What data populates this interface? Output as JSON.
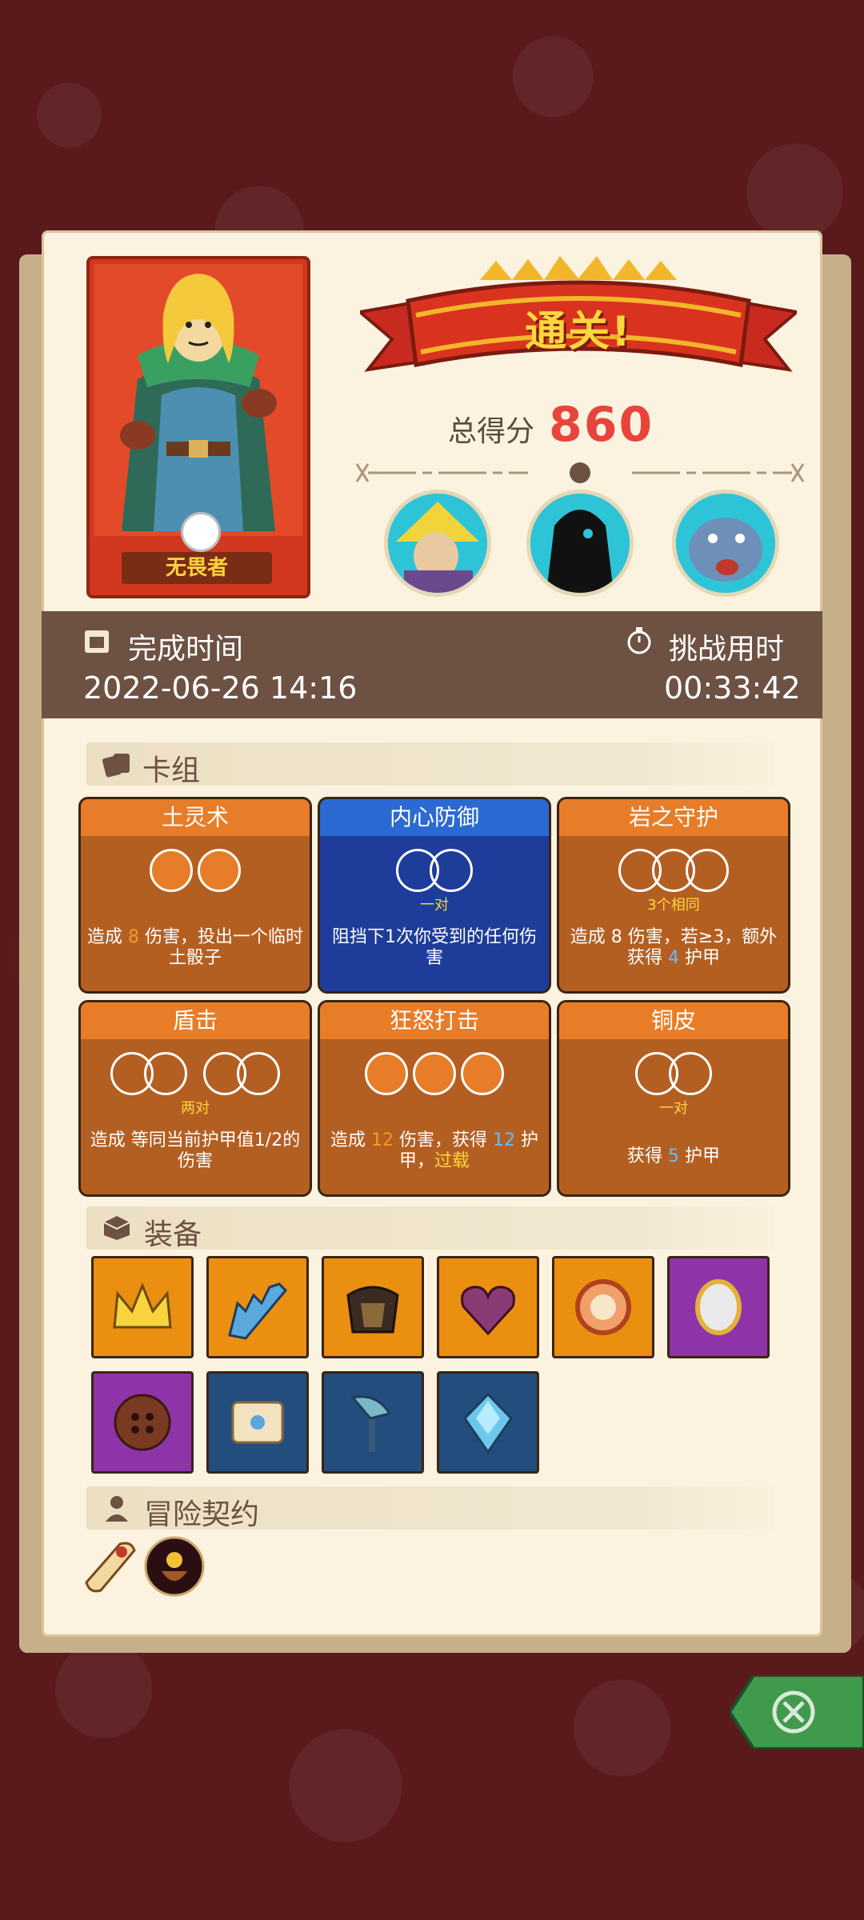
{
  "result": {
    "banner": "通关!",
    "score_label": "总得分",
    "score_value": "860"
  },
  "hero": {
    "name": "无畏者"
  },
  "bosses": [
    "boss-1",
    "boss-2",
    "boss-3"
  ],
  "times": {
    "finish_label": "完成时间",
    "finish_value": "2022-06-26 14:16",
    "challenge_label": "挑战用时",
    "challenge_value": "00:33:42"
  },
  "deck": {
    "title": "卡组",
    "cards": [
      {
        "name": "土灵术",
        "sub": "",
        "desc_a": "造成 ",
        "desc_b": "8",
        "desc_c": " 伤害，投出一个临时土骰子"
      },
      {
        "name": "内心防御",
        "sub": "一对",
        "desc_a": "阻挡下1次你受到的任何伤害",
        "desc_b": "",
        "desc_c": ""
      },
      {
        "name": "岩之守护",
        "sub": "3个相同",
        "desc_a": "造成 ",
        "desc_b": "8",
        "desc_c": " 伤害，若",
        "desc_d": "≥3，额外获得 ",
        "desc_e": "4",
        "desc_f": " 护甲"
      },
      {
        "name": "盾击",
        "sub": "两对",
        "desc_a": "造成 等同当前",
        "desc_b": "护甲值1/2的伤害"
      },
      {
        "name": "狂怒打击",
        "sub": "",
        "desc_a": "造成 ",
        "desc_b": "12",
        "desc_c": " 伤害，获得 ",
        "desc_d": "12",
        "desc_e": " 护甲，",
        "desc_f": "过载"
      },
      {
        "name": "铜皮",
        "sub": "一对",
        "desc_a": "获得 ",
        "desc_b": "5",
        "desc_c": " 护甲"
      }
    ]
  },
  "equipment": {
    "title": "装备",
    "items": [
      "crown",
      "saw-blade",
      "armor",
      "heart",
      "ring",
      "mirror",
      "button",
      "scroll",
      "axe",
      "crystal"
    ]
  },
  "contract": {
    "title": "冒险契约",
    "items": [
      "scroll-contract",
      "pot-contract"
    ]
  },
  "colors": {
    "background": "#5a1a1c",
    "panel": "#fbf3df",
    "score": "#e8443b",
    "banner": "#ffd63d",
    "card_orange": "#e77d28",
    "card_blue": "#2a6ad2",
    "equip_orange": "#eb8f10",
    "equip_purple": "#8f33a8",
    "equip_blue": "#234d7c"
  }
}
